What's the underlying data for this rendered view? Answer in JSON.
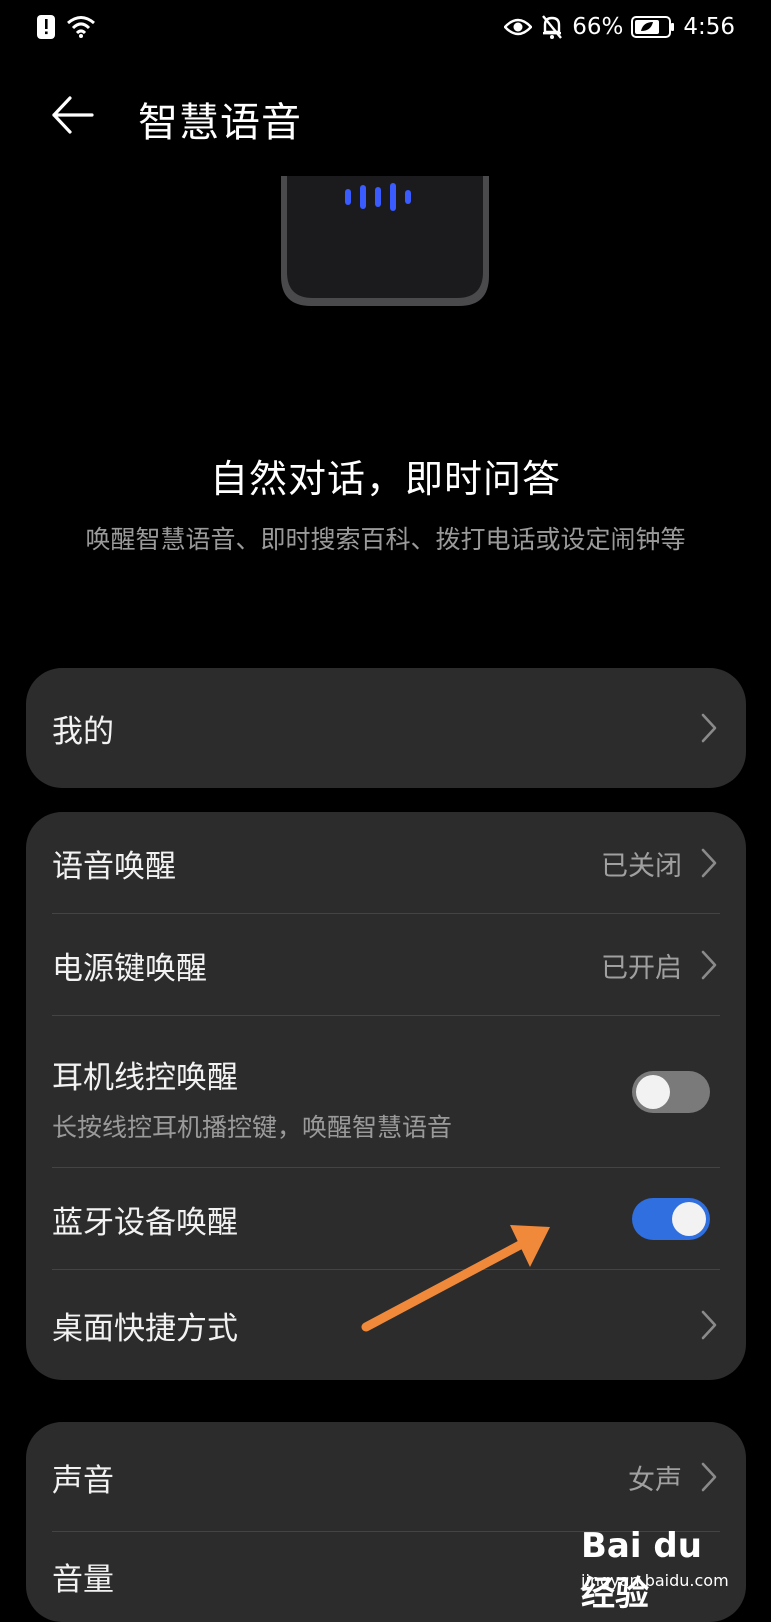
{
  "status_bar": {
    "battery_percent": "66%",
    "time": "4:56",
    "icons_left": [
      "alert-icon",
      "wifi-icon"
    ],
    "icons_right": [
      "eye-comfort-icon",
      "mute-bell-icon",
      "battery-icon"
    ]
  },
  "header": {
    "title": "智慧语音",
    "back_icon": "back-arrow-icon"
  },
  "hero": {
    "title": "自然对话，即时问答",
    "subtitle": "唤醒智慧语音、即时搜索百科、拨打电话或设定闹钟等",
    "voice_bar_color": "#3a5bff"
  },
  "card_mine": {
    "label": "我的"
  },
  "card_wake": {
    "voice_wake": {
      "label": "语音唤醒",
      "value": "已关闭"
    },
    "power_key_wake": {
      "label": "电源键唤醒",
      "value": "已开启"
    },
    "headset_wake": {
      "label": "耳机线控唤醒",
      "sublabel": "长按线控耳机播控键，唤醒智慧语音",
      "toggle": "off"
    },
    "bluetooth_wake": {
      "label": "蓝牙设备唤醒",
      "toggle": "on"
    },
    "desktop_shortcut": {
      "label": "桌面快捷方式"
    }
  },
  "card_sound": {
    "voice": {
      "label": "声音",
      "value": "女声"
    },
    "volume": {
      "label": "音量"
    }
  },
  "colors": {
    "toggle_on": "#2f6fe0",
    "toggle_off": "#7a7a7a",
    "annotation_arrow": "#f08a3a"
  },
  "watermark": {
    "logo": "Bai du 经验",
    "url": "jingyan.baidu.com"
  }
}
